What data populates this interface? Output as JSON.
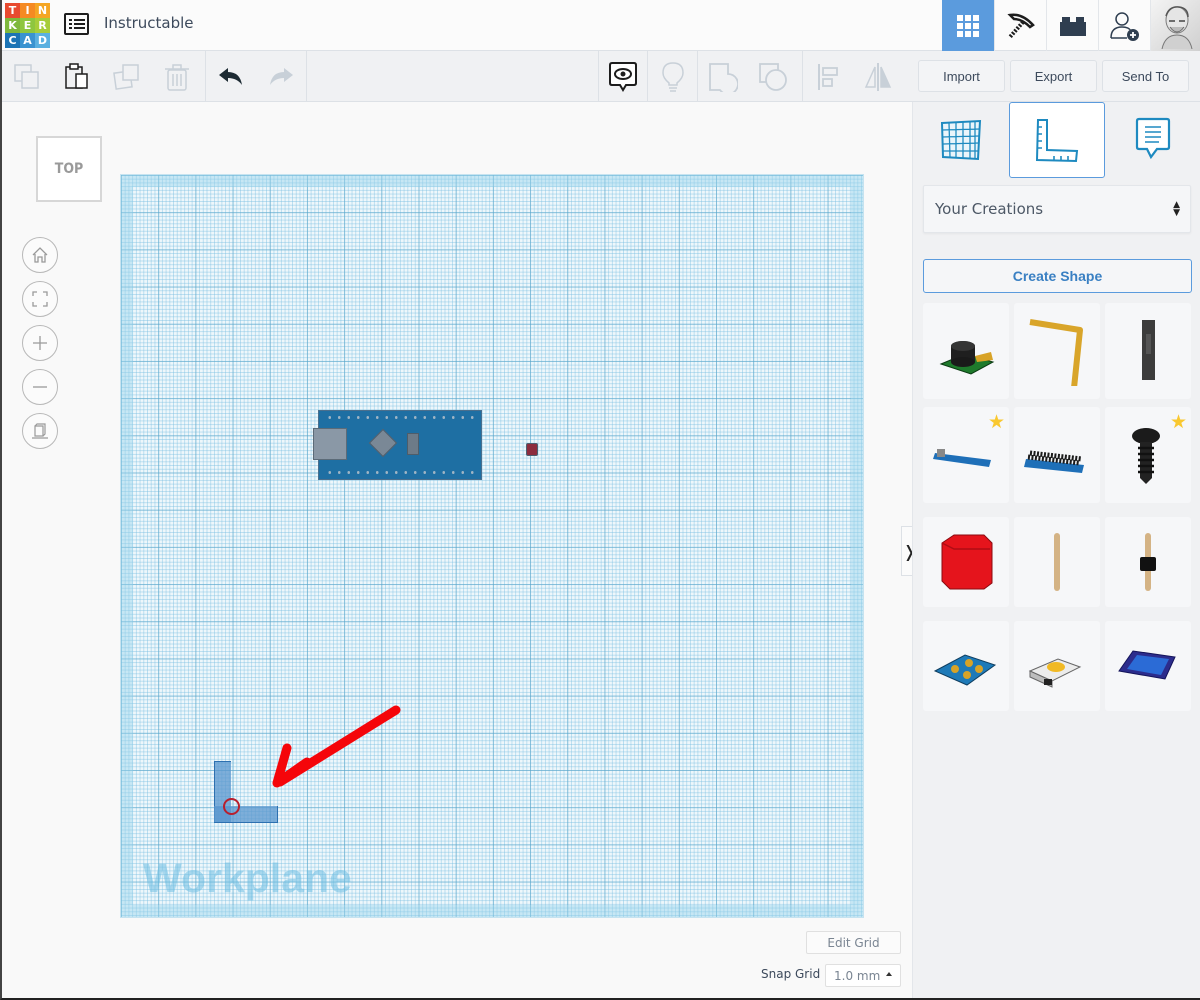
{
  "app": {
    "logo_letters": [
      "T",
      "I",
      "N",
      "K",
      "E",
      "R",
      "C",
      "A",
      "D"
    ],
    "logo_colors": [
      "#e84a2f",
      "#f58a22",
      "#f5a623",
      "#7eb83c",
      "#8ec63f",
      "#a7cd3a",
      "#1c74b5",
      "#3a93d0",
      "#5ab0e0"
    ],
    "design_title": "Instructable"
  },
  "header": {
    "buttons": [
      {
        "name": "3d-design",
        "icon": "grid-icon",
        "active": true
      },
      {
        "name": "minecraft-mode",
        "icon": "pickaxe-icon",
        "active": false
      },
      {
        "name": "brick-mode",
        "icon": "brick-icon",
        "active": false
      },
      {
        "name": "invite-user",
        "icon": "add-user-icon",
        "active": false
      }
    ],
    "avatar": "user-avatar"
  },
  "toolbar": {
    "edit_tools": [
      "copy",
      "paste",
      "duplicate",
      "delete"
    ],
    "history_tools": [
      "undo",
      "redo"
    ],
    "view_tools": [
      "notes-visibility",
      "light",
      "group",
      "ungroup",
      "align",
      "mirror"
    ],
    "import_label": "Import",
    "export_label": "Export",
    "send_to_label": "Send To"
  },
  "workspace": {
    "view_cube_label": "TOP",
    "nav_controls": [
      "home",
      "fit-all",
      "zoom-in",
      "zoom-out",
      "perspective"
    ],
    "workplane_label": "Workplane",
    "edit_grid_label": "Edit Grid",
    "snap_grid_label": "Snap Grid",
    "snap_grid_value": "1.0 mm",
    "objects": [
      "arduino-nano",
      "led",
      "l-shape-ruler"
    ]
  },
  "panel": {
    "tabs": [
      {
        "name": "workplane-tab",
        "active": false
      },
      {
        "name": "ruler-tab",
        "active": true
      },
      {
        "name": "notes-tab",
        "active": false
      }
    ],
    "category": "Your Creations",
    "create_shape_label": "Create Shape",
    "shapes": [
      {
        "name": "buzzer-module",
        "starred": false
      },
      {
        "name": "bent-wire",
        "starred": false
      },
      {
        "name": "jumper-housing",
        "starred": false
      },
      {
        "name": "arduino-nano-flat",
        "starred": true
      },
      {
        "name": "arduino-nano-headers",
        "starred": true
      },
      {
        "name": "screw",
        "starred": true
      },
      {
        "name": "red-cap",
        "starred": false
      },
      {
        "name": "pin",
        "starred": false
      },
      {
        "name": "pin-header",
        "starred": false
      },
      {
        "name": "button-module",
        "starred": false
      },
      {
        "name": "tactile-switch",
        "starred": false
      },
      {
        "name": "oled-display",
        "starred": false
      }
    ]
  }
}
